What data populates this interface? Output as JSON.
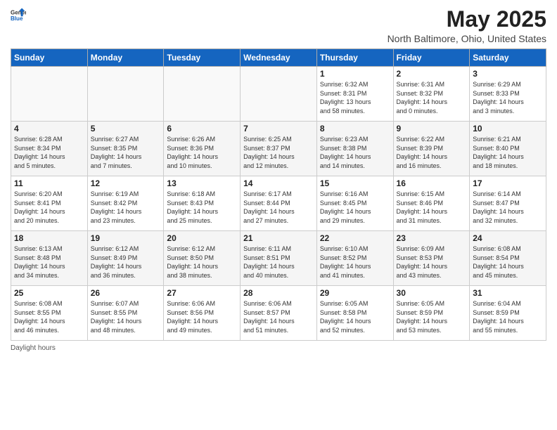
{
  "header": {
    "logo_general": "General",
    "logo_blue": "Blue",
    "title": "May 2025",
    "subtitle": "North Baltimore, Ohio, United States"
  },
  "columns": [
    "Sunday",
    "Monday",
    "Tuesday",
    "Wednesday",
    "Thursday",
    "Friday",
    "Saturday"
  ],
  "footer": {
    "daylight_label": "Daylight hours"
  },
  "weeks": [
    {
      "days": [
        {
          "num": "",
          "info": ""
        },
        {
          "num": "",
          "info": ""
        },
        {
          "num": "",
          "info": ""
        },
        {
          "num": "",
          "info": ""
        },
        {
          "num": "1",
          "info": "Sunrise: 6:32 AM\nSunset: 8:31 PM\nDaylight: 13 hours\nand 58 minutes."
        },
        {
          "num": "2",
          "info": "Sunrise: 6:31 AM\nSunset: 8:32 PM\nDaylight: 14 hours\nand 0 minutes."
        },
        {
          "num": "3",
          "info": "Sunrise: 6:29 AM\nSunset: 8:33 PM\nDaylight: 14 hours\nand 3 minutes."
        }
      ]
    },
    {
      "days": [
        {
          "num": "4",
          "info": "Sunrise: 6:28 AM\nSunset: 8:34 PM\nDaylight: 14 hours\nand 5 minutes."
        },
        {
          "num": "5",
          "info": "Sunrise: 6:27 AM\nSunset: 8:35 PM\nDaylight: 14 hours\nand 7 minutes."
        },
        {
          "num": "6",
          "info": "Sunrise: 6:26 AM\nSunset: 8:36 PM\nDaylight: 14 hours\nand 10 minutes."
        },
        {
          "num": "7",
          "info": "Sunrise: 6:25 AM\nSunset: 8:37 PM\nDaylight: 14 hours\nand 12 minutes."
        },
        {
          "num": "8",
          "info": "Sunrise: 6:23 AM\nSunset: 8:38 PM\nDaylight: 14 hours\nand 14 minutes."
        },
        {
          "num": "9",
          "info": "Sunrise: 6:22 AM\nSunset: 8:39 PM\nDaylight: 14 hours\nand 16 minutes."
        },
        {
          "num": "10",
          "info": "Sunrise: 6:21 AM\nSunset: 8:40 PM\nDaylight: 14 hours\nand 18 minutes."
        }
      ]
    },
    {
      "days": [
        {
          "num": "11",
          "info": "Sunrise: 6:20 AM\nSunset: 8:41 PM\nDaylight: 14 hours\nand 20 minutes."
        },
        {
          "num": "12",
          "info": "Sunrise: 6:19 AM\nSunset: 8:42 PM\nDaylight: 14 hours\nand 23 minutes."
        },
        {
          "num": "13",
          "info": "Sunrise: 6:18 AM\nSunset: 8:43 PM\nDaylight: 14 hours\nand 25 minutes."
        },
        {
          "num": "14",
          "info": "Sunrise: 6:17 AM\nSunset: 8:44 PM\nDaylight: 14 hours\nand 27 minutes."
        },
        {
          "num": "15",
          "info": "Sunrise: 6:16 AM\nSunset: 8:45 PM\nDaylight: 14 hours\nand 29 minutes."
        },
        {
          "num": "16",
          "info": "Sunrise: 6:15 AM\nSunset: 8:46 PM\nDaylight: 14 hours\nand 31 minutes."
        },
        {
          "num": "17",
          "info": "Sunrise: 6:14 AM\nSunset: 8:47 PM\nDaylight: 14 hours\nand 32 minutes."
        }
      ]
    },
    {
      "days": [
        {
          "num": "18",
          "info": "Sunrise: 6:13 AM\nSunset: 8:48 PM\nDaylight: 14 hours\nand 34 minutes."
        },
        {
          "num": "19",
          "info": "Sunrise: 6:12 AM\nSunset: 8:49 PM\nDaylight: 14 hours\nand 36 minutes."
        },
        {
          "num": "20",
          "info": "Sunrise: 6:12 AM\nSunset: 8:50 PM\nDaylight: 14 hours\nand 38 minutes."
        },
        {
          "num": "21",
          "info": "Sunrise: 6:11 AM\nSunset: 8:51 PM\nDaylight: 14 hours\nand 40 minutes."
        },
        {
          "num": "22",
          "info": "Sunrise: 6:10 AM\nSunset: 8:52 PM\nDaylight: 14 hours\nand 41 minutes."
        },
        {
          "num": "23",
          "info": "Sunrise: 6:09 AM\nSunset: 8:53 PM\nDaylight: 14 hours\nand 43 minutes."
        },
        {
          "num": "24",
          "info": "Sunrise: 6:08 AM\nSunset: 8:54 PM\nDaylight: 14 hours\nand 45 minutes."
        }
      ]
    },
    {
      "days": [
        {
          "num": "25",
          "info": "Sunrise: 6:08 AM\nSunset: 8:55 PM\nDaylight: 14 hours\nand 46 minutes."
        },
        {
          "num": "26",
          "info": "Sunrise: 6:07 AM\nSunset: 8:55 PM\nDaylight: 14 hours\nand 48 minutes."
        },
        {
          "num": "27",
          "info": "Sunrise: 6:06 AM\nSunset: 8:56 PM\nDaylight: 14 hours\nand 49 minutes."
        },
        {
          "num": "28",
          "info": "Sunrise: 6:06 AM\nSunset: 8:57 PM\nDaylight: 14 hours\nand 51 minutes."
        },
        {
          "num": "29",
          "info": "Sunrise: 6:05 AM\nSunset: 8:58 PM\nDaylight: 14 hours\nand 52 minutes."
        },
        {
          "num": "30",
          "info": "Sunrise: 6:05 AM\nSunset: 8:59 PM\nDaylight: 14 hours\nand 53 minutes."
        },
        {
          "num": "31",
          "info": "Sunrise: 6:04 AM\nSunset: 8:59 PM\nDaylight: 14 hours\nand 55 minutes."
        }
      ]
    }
  ]
}
